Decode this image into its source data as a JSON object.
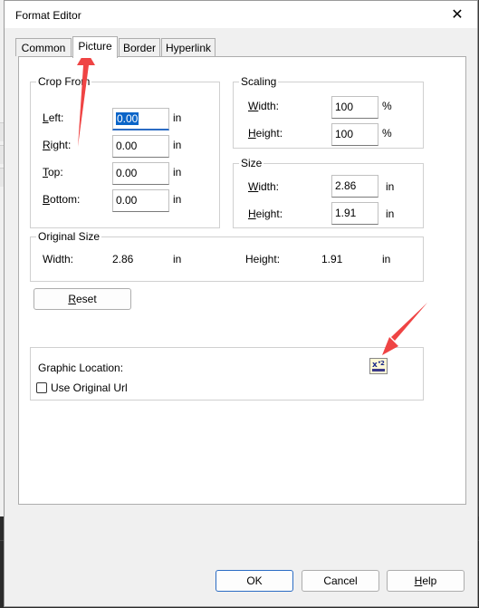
{
  "window": {
    "title": "Format Editor"
  },
  "tabs": [
    {
      "label": "Common"
    },
    {
      "label": "Picture"
    },
    {
      "label": "Border"
    },
    {
      "label": "Hyperlink"
    }
  ],
  "crop": {
    "legend": "Crop From",
    "left_label": "Left:",
    "left_value": "0.00",
    "right_label": "Right:",
    "right_value": "0.00",
    "top_label": "Top:",
    "top_value": "0.00",
    "bottom_label": "Bottom:",
    "bottom_value": "0.00",
    "unit": "in"
  },
  "scaling": {
    "legend": "Scaling",
    "width_label": "Width:",
    "width_value": "100",
    "height_label": "Height:",
    "height_value": "100",
    "unit": "%"
  },
  "size": {
    "legend": "Size",
    "width_label": "Width:",
    "width_value": "2.86",
    "height_label": "Height:",
    "height_value": "1.91",
    "unit": "in"
  },
  "original_size": {
    "legend": "Original Size",
    "width_label": "Width:",
    "width_value": "2.86",
    "height_label": "Height:",
    "height_value": "1.91",
    "unit": "in"
  },
  "reset_label": "Reset",
  "graphic": {
    "location_label": "Graphic Location:",
    "use_original_url_label": "Use Original Url",
    "use_original_url_checked": false,
    "formula_icon": "x-squared-formula-icon"
  },
  "buttons": {
    "ok": "OK",
    "cancel": "Cancel",
    "help": "Help"
  },
  "colors": {
    "annotation_arrow": "#ef4444",
    "focus_accent": "#2b6cc4",
    "selection": "#0a64c8"
  }
}
